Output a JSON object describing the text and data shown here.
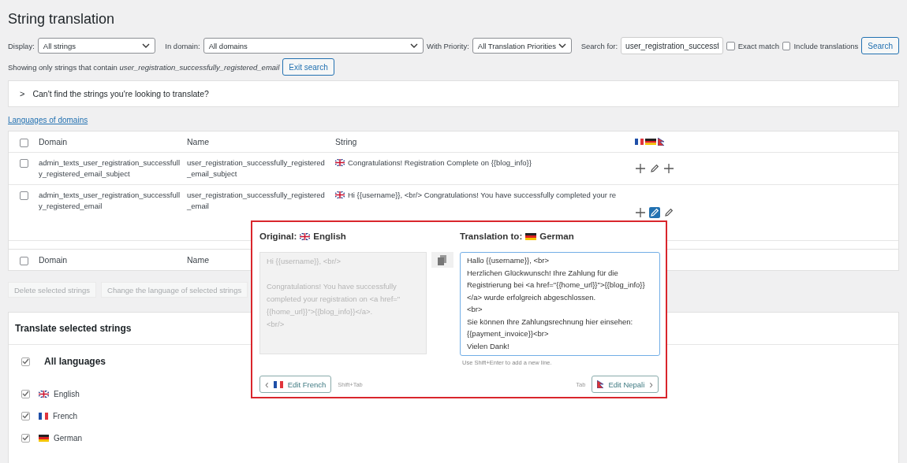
{
  "title": "String translation",
  "filters": {
    "display_label": "Display:",
    "display_value": "All strings",
    "domain_label": "In domain:",
    "domain_value": "All domains",
    "priority_label": "With Priority:",
    "priority_value": "All Translation Priorities",
    "search_label": "Search for:",
    "search_value": "user_registration_successf",
    "exact_match": {
      "label": "Exact match",
      "checked": false
    },
    "include_translations": {
      "label": "Include translations",
      "checked": false
    },
    "search_button": "Search"
  },
  "search_notice": "Showing only strings that contain *user_registration_successfully_registered_email*",
  "exit_search": "Exit search",
  "help_panel": {
    "caret": ">",
    "text": "Can't find the strings you're looking to translate?"
  },
  "languages_link": "Languages of domains",
  "table": {
    "header_checked": false,
    "footer_checked": false,
    "columns": [
      "Domain",
      "Name",
      "String"
    ],
    "rows": [
      {
        "checked": false,
        "domain": "admin_texts_user_registration_successfully_registered_email_subject",
        "name": "user_registration_successfully_registered_email_subject",
        "string": "Congratulations! Registration Complete on {{blog_info}}",
        "actions": [
          {
            "kind": "add",
            "selected": false
          },
          {
            "kind": "edit",
            "selected": false
          },
          {
            "kind": "add",
            "selected": false
          }
        ]
      },
      {
        "checked": false,
        "domain": "admin_texts_user_registration_successfully_registered_email",
        "name": "user_registration_successfully_registered_email",
        "string": "Hi {{username}}, <br/> Congratulations! You have successfully completed your re",
        "actions": [
          {
            "kind": "add",
            "selected": false
          },
          {
            "kind": "edit",
            "selected": true
          },
          {
            "kind": "edit",
            "selected": false
          }
        ]
      }
    ],
    "footer_columns": [
      "Domain",
      "Name"
    ]
  },
  "bulk_buttons": [
    "Delete selected strings",
    "Change the language of selected strings"
  ],
  "translate_panel": {
    "title": "Translate selected strings",
    "all": {
      "label": "All languages",
      "checked": true
    },
    "languages": [
      {
        "label": "English",
        "checked": true
      },
      {
        "label": "French",
        "checked": true
      },
      {
        "label": "German",
        "checked": true
      }
    ]
  },
  "editor": {
    "original_label": "Original:",
    "original_language": "English",
    "translation_label": "Translation to:",
    "translation_language": "German",
    "original_text": "Hi {{username}}, <br/>\n\nCongratulations! You have successfully completed your registration on <a href=\"{{home_url}}\">{{blog_info}}</a>.\n<br/>",
    "translation_text": "Hallo {{username}}, <br>\nHerzlichen Glückwunsch! Ihre Zahlung für die Registrierung bei <a href=\"{{home_url}}\">{{blog_info}}</a> wurde erfolgreich abgeschlossen.\n<br>\nSie können Ihre Zahlungsrechnung hier einsehen: {{payment_invoice}}<br>\nVielen Dank!",
    "hint": "Use Shift+Enter to add a new line.",
    "prev_button": "Edit French",
    "prev_arrow": "‹",
    "prev_shortcut": "Shift+Tab",
    "next_shortcut": "Tab",
    "next_button": "Edit Nepali",
    "next_arrow": "›"
  }
}
